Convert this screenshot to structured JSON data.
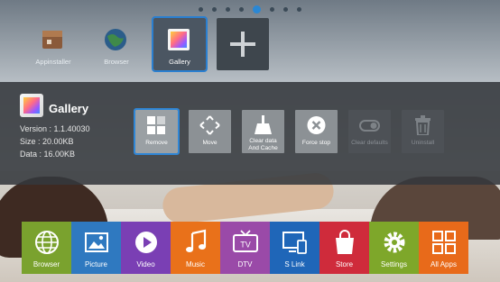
{
  "pager": {
    "page_count": 8,
    "active_index": 4
  },
  "top_apps": [
    {
      "label": "Appinstaller"
    },
    {
      "label": "Browser"
    },
    {
      "label": "Gallery"
    }
  ],
  "info": {
    "title": "Gallery",
    "version": "Version : 1.1.40030",
    "size": "Size : 20.00KB",
    "data": "Data : 16.00KB"
  },
  "actions": [
    {
      "label": "Remove",
      "state": "selected"
    },
    {
      "label": "Move",
      "state": "enabled"
    },
    {
      "label_line1": "Clear data",
      "label_line2": "And Cache",
      "state": "enabled"
    },
    {
      "label": "Force stop",
      "state": "enabled"
    },
    {
      "label": "Clear defaults",
      "state": "disabled"
    },
    {
      "label": "Uninstall",
      "state": "disabled"
    }
  ],
  "dock": [
    {
      "label": "Browser"
    },
    {
      "label": "Picture"
    },
    {
      "label": "Video"
    },
    {
      "label": "Music"
    },
    {
      "label": "DTV"
    },
    {
      "label": "S Link"
    },
    {
      "label": "Store"
    },
    {
      "label": "Settings"
    },
    {
      "label": "All Apps"
    }
  ],
  "colors": {
    "focus": "#2f86d6",
    "panel": "#34383c"
  }
}
